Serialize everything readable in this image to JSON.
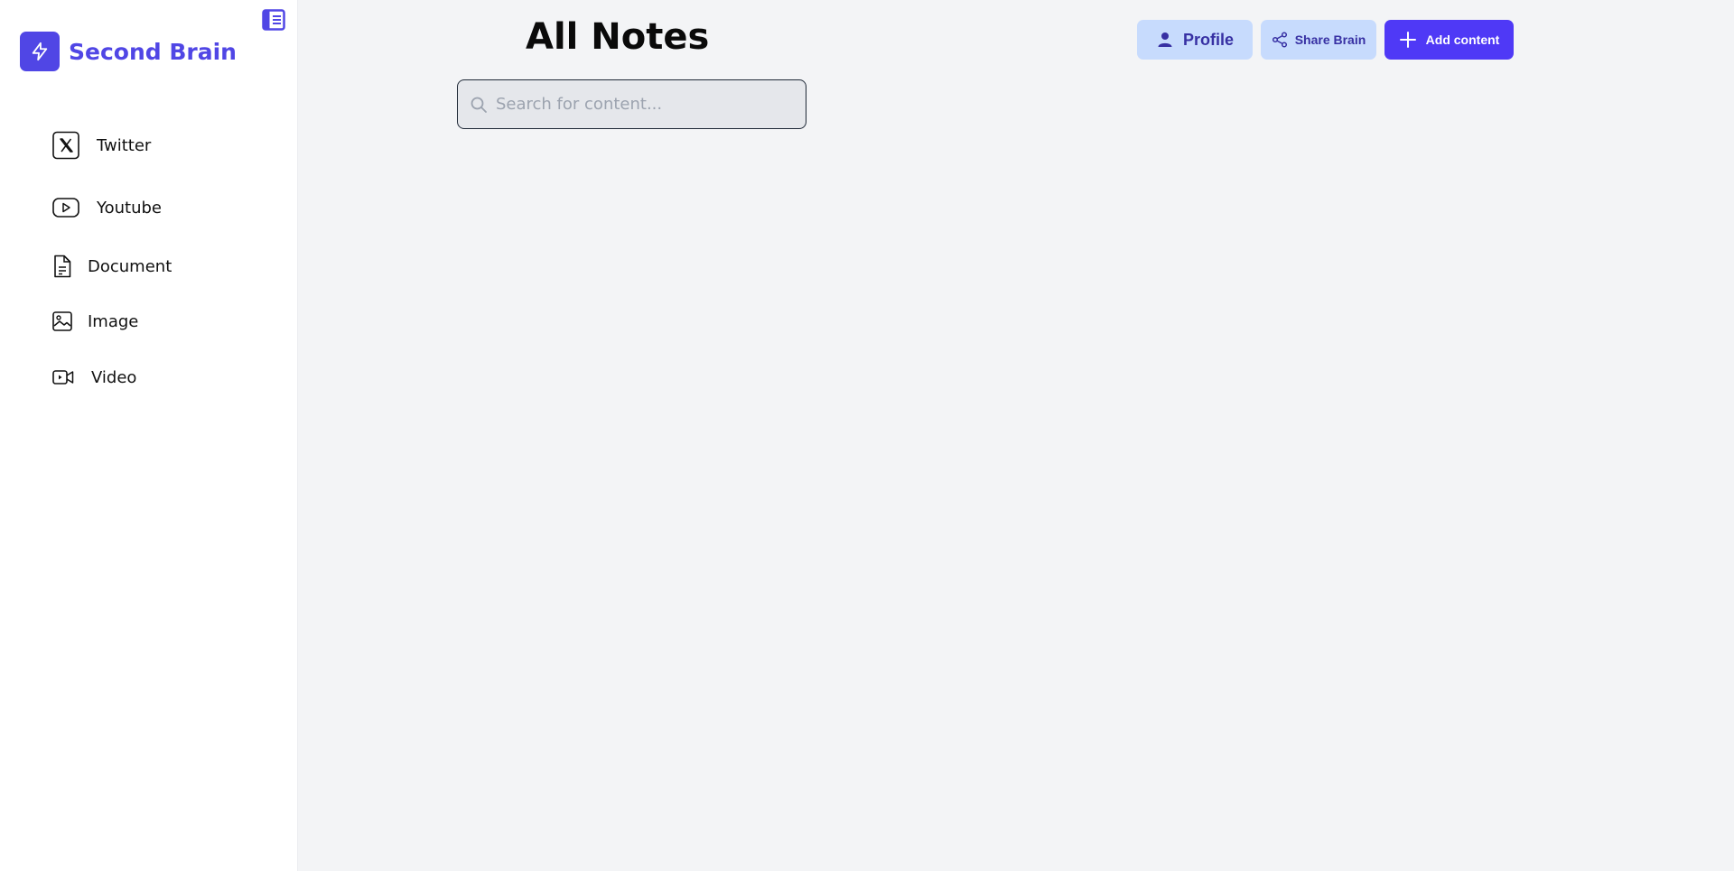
{
  "app": {
    "name": "Second Brain",
    "accent_color": "#5046e5"
  },
  "sidebar": {
    "collapse_icon": "sidebar-toggle-icon",
    "items": [
      {
        "label": "Twitter",
        "icon": "twitter-x-icon"
      },
      {
        "label": "Youtube",
        "icon": "youtube-icon"
      },
      {
        "label": "Document",
        "icon": "document-icon"
      },
      {
        "label": "Image",
        "icon": "image-icon"
      },
      {
        "label": "Video",
        "icon": "video-icon"
      }
    ]
  },
  "main": {
    "title": "All Notes",
    "search": {
      "placeholder": "Search for content...",
      "value": ""
    }
  },
  "header": {
    "buttons": [
      {
        "label": "Profile",
        "icon": "user-icon",
        "style": "light"
      },
      {
        "label": "Share Brain",
        "icon": "share-icon",
        "style": "light"
      },
      {
        "label": "Add content",
        "icon": "plus-icon",
        "style": "primary"
      }
    ],
    "colors": {
      "light_bg": "#c7dbfd",
      "light_text": "#3730a3",
      "primary_bg": "#4f39f6"
    }
  }
}
